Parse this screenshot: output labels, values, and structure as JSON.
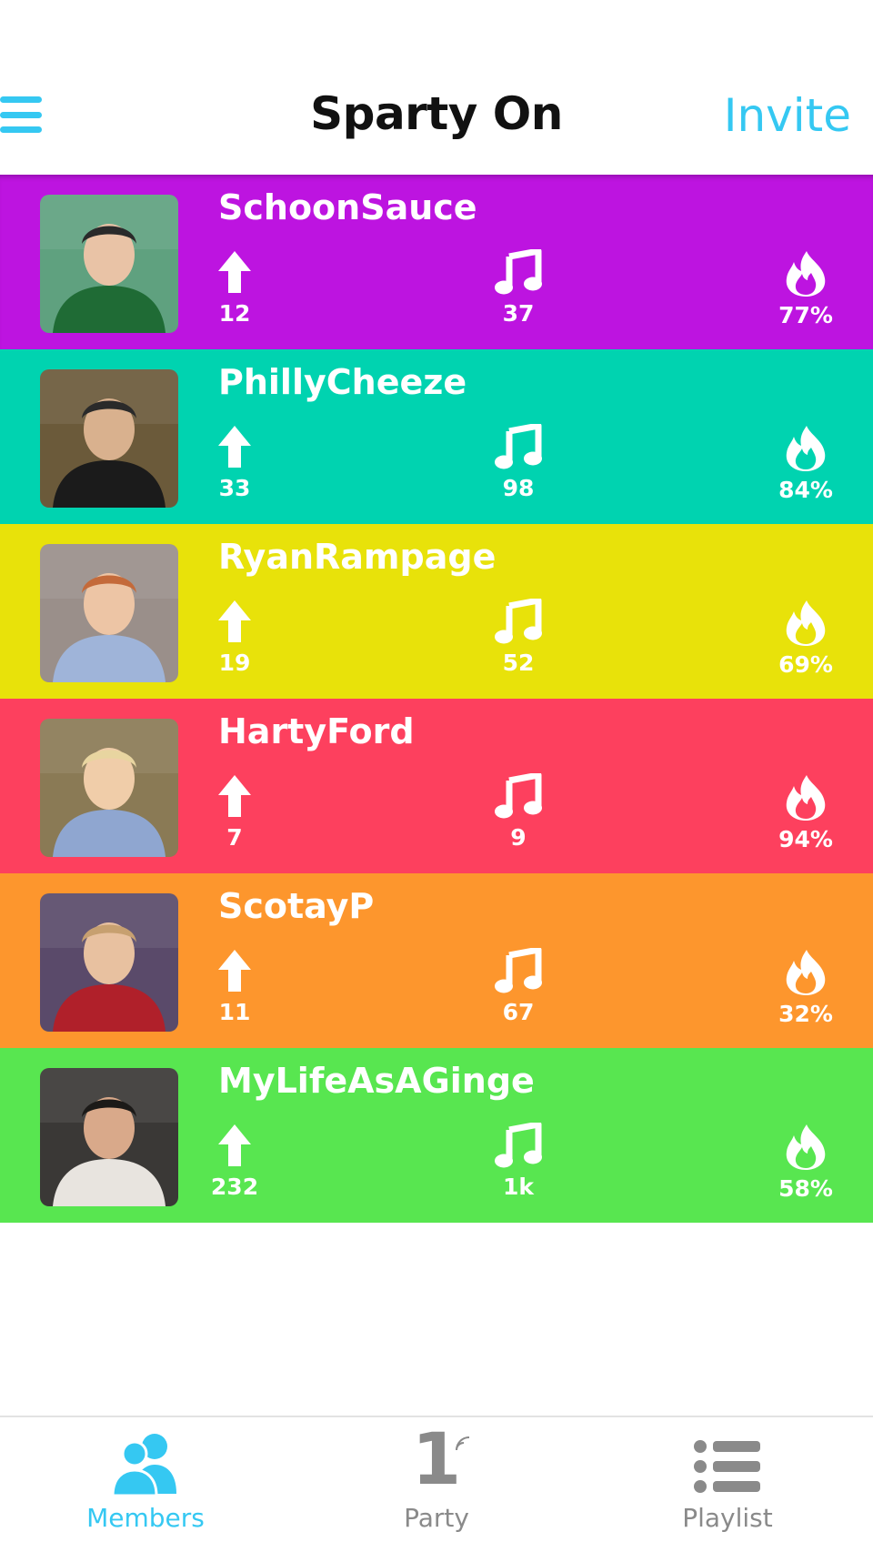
{
  "header": {
    "menu_icon": "menu-icon",
    "title": "Sparty On",
    "invite_label": "Invite"
  },
  "colors": {
    "accent": "#35c8f2",
    "tab_inactive": "#8a8a8a",
    "rows": [
      "#bd14e0",
      "#00d3b0",
      "#e8e20a",
      "#fd405e",
      "#fd962d",
      "#58e650"
    ]
  },
  "members": [
    {
      "name": "SchoonSauce",
      "upvotes": "12",
      "songs": "37",
      "hot": "77%",
      "color": "#bd14e0",
      "avatar": "avatar-photo"
    },
    {
      "name": "PhillyCheeze",
      "upvotes": "33",
      "songs": "98",
      "hot": "84%",
      "color": "#00d3b0",
      "avatar": "avatar-photo"
    },
    {
      "name": "RyanRampage",
      "upvotes": "19",
      "songs": "52",
      "hot": "69%",
      "color": "#e8e20a",
      "avatar": "avatar-photo"
    },
    {
      "name": "HartyFord",
      "upvotes": "7",
      "songs": "9",
      "hot": "94%",
      "color": "#fd405e",
      "avatar": "avatar-photo"
    },
    {
      "name": "ScotayP",
      "upvotes": "11",
      "songs": "67",
      "hot": "32%",
      "color": "#fd962d",
      "avatar": "avatar-photo"
    },
    {
      "name": "MyLifeAsAGinge",
      "upvotes": "232",
      "songs": "1k",
      "hot": "58%",
      "color": "#58e650",
      "avatar": "avatar-photo"
    }
  ],
  "stat_icons": [
    "upvote-arrow-icon",
    "music-note-icon",
    "flame-icon"
  ],
  "tabs": [
    {
      "label": "Members",
      "icon": "members-icon",
      "active": true
    },
    {
      "label": "Party",
      "icon": "party-number-icon",
      "number": "1",
      "active": false
    },
    {
      "label": "Playlist",
      "icon": "playlist-icon",
      "active": false
    }
  ]
}
